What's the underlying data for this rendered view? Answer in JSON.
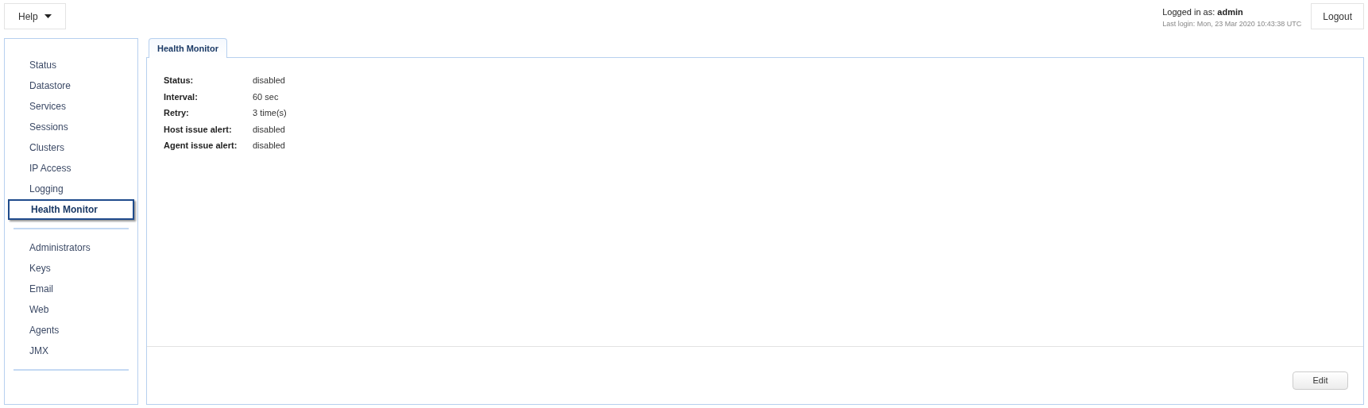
{
  "header": {
    "help_menu": "Help",
    "user": "Logged in as: **admin**",
    "last_login": "Last login: Mon, 23 Mar 2020 10:43:38 UTC",
    "logout": "Logout"
  },
  "sidebar": {
    "groups": [
      {
        "items": [
          {
            "label": "Status",
            "selected": false
          },
          {
            "label": "Datastore",
            "selected": false
          },
          {
            "label": "Services",
            "selected": false
          },
          {
            "label": "Sessions",
            "selected": false
          },
          {
            "label": "Clusters",
            "selected": false
          },
          {
            "label": "IP Access",
            "selected": false
          },
          {
            "label": "Logging",
            "selected": false
          },
          {
            "label": "Health Monitor",
            "selected": true
          }
        ]
      },
      {
        "items": [
          {
            "label": "Administrators",
            "selected": false
          },
          {
            "label": "Keys",
            "selected": false
          },
          {
            "label": "Email",
            "selected": false
          },
          {
            "label": "Web",
            "selected": false
          },
          {
            "label": "Agents",
            "selected": false
          },
          {
            "label": "JMX",
            "selected": false
          }
        ]
      }
    ]
  },
  "tabs": [
    {
      "label": "Health Monitor",
      "selected": true
    }
  ],
  "fields": [
    {
      "label": "Status:",
      "value": "disabled"
    },
    {
      "label": "Interval:",
      "value": "60 sec"
    },
    {
      "label": "Retry:",
      "value": "3 time(s)"
    },
    {
      "label": "Host issue alert:",
      "value": "disabled"
    },
    {
      "label": "Agent issue alert:",
      "value": "disabled"
    }
  ],
  "actions": {
    "edit": "Edit"
  }
}
